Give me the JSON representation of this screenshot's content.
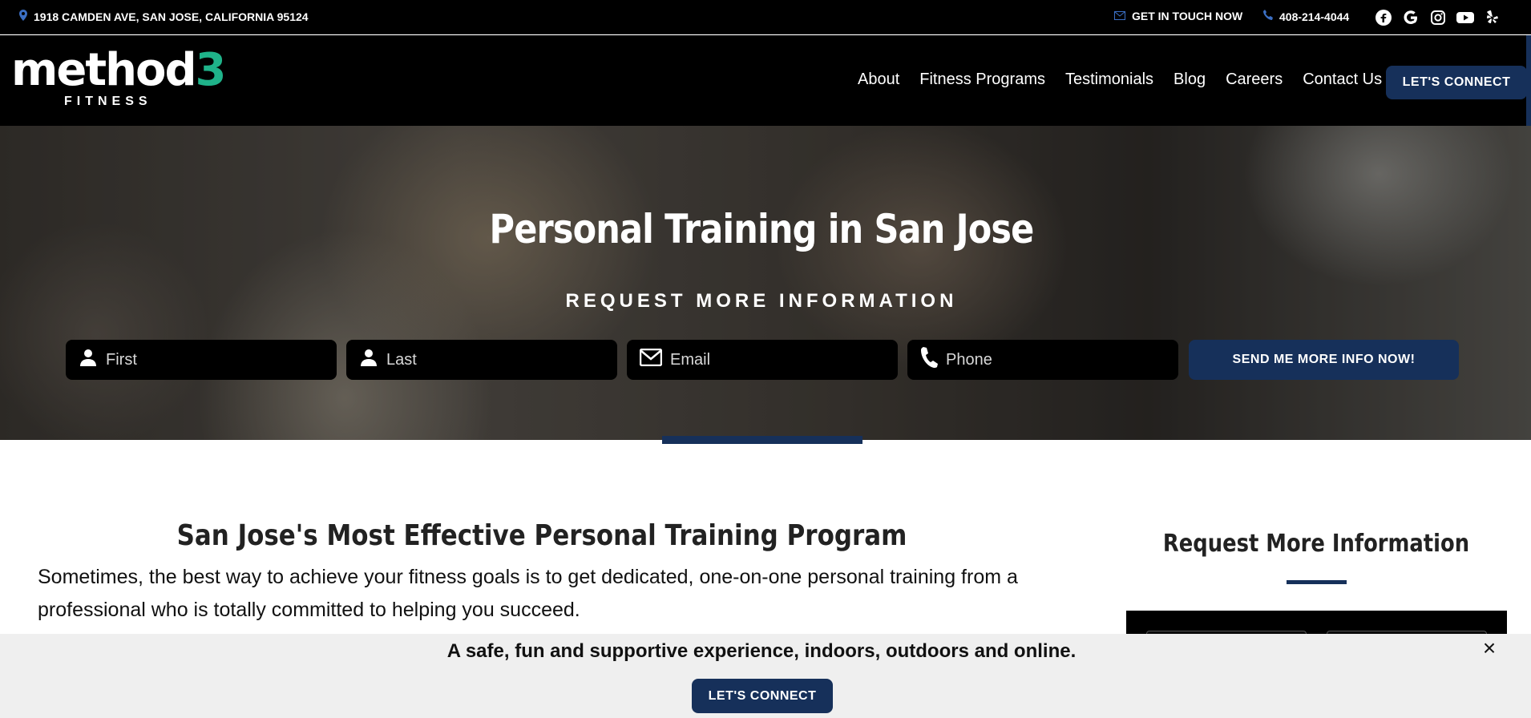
{
  "topbar": {
    "address": "1918 CAMDEN AVE, SAN JOSE, CALIFORNIA 95124",
    "contact_label": "GET IN TOUCH NOW",
    "phone": "408-214-4044",
    "social_icons": [
      "facebook-icon",
      "google-icon",
      "instagram-icon",
      "youtube-icon",
      "yelp-icon"
    ]
  },
  "header": {
    "logo_word": "method",
    "logo_number": "3",
    "logo_sub": "FITNESS",
    "nav": [
      "About",
      "Fitness Programs",
      "Testimonials",
      "Blog",
      "Careers",
      "Contact Us"
    ],
    "cta": "LET'S CONNECT"
  },
  "hero": {
    "title": "Personal Training in San Jose",
    "subtitle": "REQUEST MORE INFORMATION",
    "fields": {
      "first": "First",
      "last": "Last",
      "email": "Email",
      "phone": "Phone"
    },
    "submit": "SEND ME MORE INFO NOW!"
  },
  "main": {
    "title": "San Jose's Most Effective Personal Training Program",
    "text": "Sometimes, the best way to achieve your fitness goals is to get dedicated, one-on-one personal training from a professional who is totally committed to helping you succeed."
  },
  "sidebar": {
    "title": "Request More Information"
  },
  "bottom_bar": {
    "text": "A safe, fun and supportive experience, indoors, outdoors and online.",
    "cta": "LET'S CONNECT",
    "close": "×"
  },
  "colors": {
    "brand_navy": "#16305a",
    "logo_accent": "#1fb38a",
    "topbar_bg": "#000000"
  }
}
